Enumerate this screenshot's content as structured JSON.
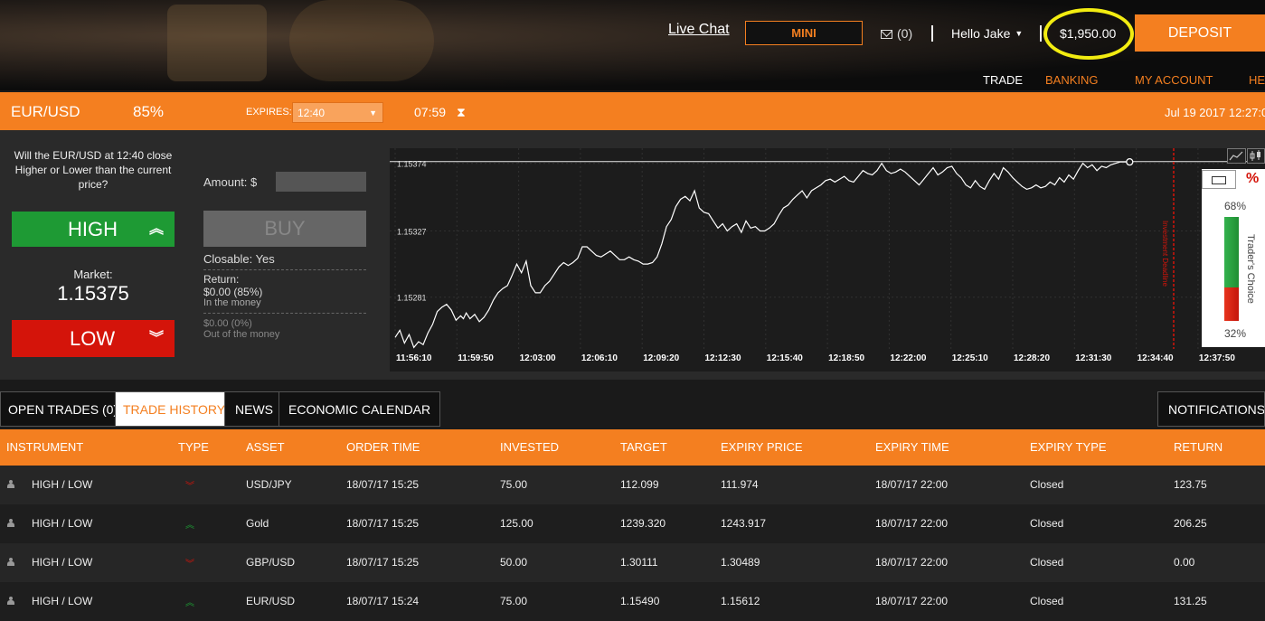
{
  "header": {
    "live_chat": "Live Chat",
    "mini": "MINI",
    "mail_count": "(0)",
    "user_greeting": "Hello Jake",
    "balance": "$1,950.00",
    "deposit": "DEPOSIT",
    "nav": [
      "TRADE",
      "BANKING",
      "MY ACCOUNT",
      "HE"
    ]
  },
  "infobar": {
    "pair": "EUR/USD",
    "payout": "85%",
    "expires_label": "EXPIRES:",
    "expires_value": "12:40",
    "countdown": "07:59",
    "datetime": "Jul 19 2017   12:27:0"
  },
  "trade": {
    "question": "Will the EUR/USD at 12:40 close Higher or Lower than the current price?",
    "high": "HIGH",
    "low": "LOW",
    "market_label": "Market:",
    "market_value": "1.15375",
    "amount_label": "Amount: $",
    "buy": "BUY",
    "closable": "Closable: Yes",
    "return_label": "Return:",
    "return_value": "$0.00 (85%)",
    "return_in": "In the money",
    "return_zero": "$0.00 (0%)",
    "return_out": "Out of the money"
  },
  "chart_data": {
    "type": "line",
    "y_tick_labels": [
      "1.15374",
      "1.15327",
      "1.15281"
    ],
    "x_tick_labels": [
      "11:56:10",
      "11:59:50",
      "12:03:00",
      "12:06:10",
      "12:09:20",
      "12:12:30",
      "12:15:40",
      "12:18:50",
      "12:22:00",
      "12:25:10",
      "12:28:20",
      "12:31:30",
      "12:34:40",
      "12:37:50"
    ],
    "ylim": [
      1.15245,
      1.15382
    ],
    "current_level": 1.15374,
    "deadline_label": "Investment Deadline",
    "series": [
      {
        "x_minutes": [
          0,
          0.5,
          1.0,
          1.5,
          2.0,
          2.5,
          3.0,
          3.5,
          4.0,
          4.5,
          5.0,
          5.5,
          6.0,
          6.5,
          7.0,
          7.3,
          7.6,
          8.0,
          8.5,
          9.0,
          9.5,
          10.0,
          10.5,
          11.0,
          11.5,
          12.0,
          12.5,
          13.0,
          13.5,
          14.0,
          14.5,
          15.0,
          15.5,
          16.0,
          16.5,
          17.0,
          17.5,
          18.0,
          18.5,
          19.0,
          19.5,
          20.0,
          20.5,
          21.0,
          21.5,
          22.0,
          22.5,
          23.0,
          23.5,
          24.0,
          24.5,
          25.0,
          25.5,
          26.0,
          26.5,
          27.0,
          27.5,
          28.0,
          28.5,
          29.0,
          29.5,
          30.0,
          30.5,
          31.0,
          31.5,
          32.0,
          32.5,
          33.0,
          33.5,
          34.0,
          34.5,
          35.0,
          35.5,
          36.0,
          36.5,
          37.0,
          37.5,
          38.0,
          38.5,
          39.0,
          39.5,
          40.0,
          40.5,
          41.0,
          41.5,
          42.0,
          42.5,
          43.0,
          43.5,
          44.0,
          44.5,
          45.0,
          45.5,
          46.0,
          46.5,
          47.0,
          47.5,
          48.0,
          48.5,
          49.0,
          49.5,
          50.0,
          50.5,
          51.0,
          51.5,
          52.0,
          52.5,
          53.0,
          53.5,
          54.0,
          54.5,
          55.0,
          55.5,
          56.0,
          56.5,
          57.0,
          57.5,
          58.0,
          58.5,
          59.0,
          59.5,
          60.0,
          60.5,
          61.0,
          61.5,
          62.0,
          62.5,
          63.0,
          63.5,
          64.0,
          64.5,
          65.0,
          65.5,
          66.0,
          66.5,
          67.0,
          67.5,
          68.0,
          68.5,
          69.0,
          69.5,
          70.0,
          70.5,
          71.0,
          71.5,
          72.0,
          72.5,
          73.0,
          73.5,
          74.0,
          74.5,
          75.0,
          75.5,
          76.0,
          76.5,
          77.0,
          77.5,
          78.0,
          78.5,
          79.0,
          79.5,
          80.0,
          80.5,
          81.0,
          81.5,
          82.0,
          82.5,
          83.0,
          83.5,
          84.0,
          84.5,
          85.0,
          85.5,
          86.0,
          86.5,
          87.0,
          87.5,
          88.0,
          88.5,
          89.0,
          89.5,
          90.0,
          90.5,
          91.0,
          91.5,
          92.0
        ],
        "values": [
          1.15253,
          1.15258,
          1.15249,
          1.15255,
          1.15246,
          1.1525,
          1.15248,
          1.15256,
          1.15262,
          1.15271,
          1.15274,
          1.15276,
          1.15272,
          1.15265,
          1.15268,
          1.15266,
          1.1527,
          1.15266,
          1.15269,
          1.15264,
          1.15267,
          1.15272,
          1.15279,
          1.15284,
          1.15287,
          1.15289,
          1.15296,
          1.15304,
          1.15298,
          1.15306,
          1.15289,
          1.15284,
          1.15284,
          1.15289,
          1.15292,
          1.15297,
          1.15302,
          1.15305,
          1.15303,
          1.15305,
          1.15308,
          1.15316,
          1.15316,
          1.15313,
          1.1531,
          1.15309,
          1.15311,
          1.15313,
          1.1531,
          1.15307,
          1.15307,
          1.15309,
          1.15307,
          1.15306,
          1.15304,
          1.15304,
          1.15305,
          1.15309,
          1.15318,
          1.1533,
          1.15335,
          1.15344,
          1.15349,
          1.15351,
          1.15348,
          1.15355,
          1.15343,
          1.1534,
          1.15339,
          1.15334,
          1.15329,
          1.15332,
          1.15327,
          1.1533,
          1.15332,
          1.15326,
          1.15334,
          1.15329,
          1.1533,
          1.15327,
          1.15327,
          1.15329,
          1.15332,
          1.15338,
          1.15343,
          1.15345,
          1.15349,
          1.15352,
          1.15355,
          1.1535,
          1.15355,
          1.15357,
          1.15359,
          1.15362,
          1.15363,
          1.15361,
          1.15363,
          1.15365,
          1.15362,
          1.15361,
          1.15365,
          1.15369,
          1.15367,
          1.15366,
          1.15369,
          1.15374,
          1.15369,
          1.15367,
          1.15368,
          1.1537,
          1.15368,
          1.15365,
          1.15362,
          1.15359,
          1.15363,
          1.15367,
          1.15371,
          1.15366,
          1.15368,
          1.15371,
          1.15372,
          1.15367,
          1.15364,
          1.15359,
          1.15357,
          1.15362,
          1.15358,
          1.15356,
          1.15362,
          1.15367,
          1.15363,
          1.15371,
          1.15368,
          1.15364,
          1.15361,
          1.15358,
          1.15356,
          1.15357,
          1.15359,
          1.15357,
          1.15358,
          1.15361,
          1.15359,
          1.15364,
          1.15361,
          1.15366,
          1.15363,
          1.15369,
          1.15374,
          1.15371,
          1.15373,
          1.15369,
          1.15372,
          1.15371,
          1.15373,
          1.15374,
          1.15375,
          1.15375,
          1.15375,
          1.15375,
          1.15375,
          1.15375,
          1.15375,
          1.15375,
          1.15375,
          1.15375,
          1.15375,
          1.15375,
          1.15375,
          1.15375,
          1.15375,
          1.15375,
          1.15375,
          1.15375,
          1.15375,
          1.15375,
          1.15375,
          1.15375,
          1.15375,
          1.15375,
          1.15375,
          1.15375,
          1.15375,
          1.15375,
          1.15375,
          1.15375,
          1.15375
        ]
      }
    ],
    "line_end_index": 159
  },
  "traders_choice": {
    "high_pct": "68%",
    "low_pct": "32%",
    "high_fraction": 0.68,
    "label": "Trader's Choice",
    "pct_icon": "%"
  },
  "tabs": [
    "OPEN TRADES (0)",
    "TRADE HISTORY",
    "NEWS",
    "ECONOMIC CALENDAR"
  ],
  "notifications": "NOTIFICATIONS (",
  "table": {
    "headers": [
      "INSTRUMENT",
      "TYPE",
      "ASSET",
      "ORDER TIME",
      "INVESTED",
      "TARGET",
      "EXPIRY PRICE",
      "EXPIRY TIME",
      "EXPIRY TYPE",
      "RETURN"
    ],
    "rows": [
      {
        "instrument": "HIGH / LOW",
        "direction": "down",
        "asset": "USD/JPY",
        "order_time": "18/07/17 15:25",
        "invested": "75.00",
        "target": "112.099",
        "expiry_price": "111.974",
        "expiry_time": "18/07/17 22:00",
        "expiry_type": "Closed",
        "return": "123.75"
      },
      {
        "instrument": "HIGH / LOW",
        "direction": "up",
        "asset": "Gold",
        "order_time": "18/07/17 15:25",
        "invested": "125.00",
        "target": "1239.320",
        "expiry_price": "1243.917",
        "expiry_time": "18/07/17 22:00",
        "expiry_type": "Closed",
        "return": "206.25"
      },
      {
        "instrument": "HIGH / LOW",
        "direction": "down",
        "asset": "GBP/USD",
        "order_time": "18/07/17 15:25",
        "invested": "50.00",
        "target": "1.30111",
        "expiry_price": "1.30489",
        "expiry_time": "18/07/17 22:00",
        "expiry_type": "Closed",
        "return": "0.00"
      },
      {
        "instrument": "HIGH / LOW",
        "direction": "up",
        "asset": "EUR/USD",
        "order_time": "18/07/17 15:24",
        "invested": "75.00",
        "target": "1.15490",
        "expiry_price": "1.15612",
        "expiry_time": "18/07/17 22:00",
        "expiry_type": "Closed",
        "return": "131.25"
      }
    ]
  },
  "colors": {
    "accent": "#f47f20",
    "high": "#1e9a34",
    "low": "#d4140a",
    "balance_highlight": "#f2ec11"
  }
}
